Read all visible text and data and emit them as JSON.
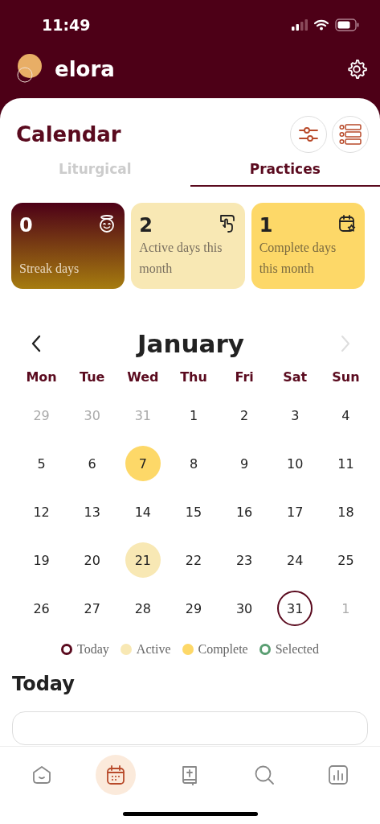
{
  "status_bar": {
    "time": "11:49"
  },
  "header": {
    "username": "elora"
  },
  "page": {
    "title": "Calendar"
  },
  "tabs": [
    {
      "label": "Liturgical",
      "selected": false
    },
    {
      "label": "Practices",
      "selected": true
    }
  ],
  "stats": [
    {
      "kind": "streak",
      "value": "0",
      "label": "Streak days"
    },
    {
      "kind": "active",
      "value": "2",
      "label": "Active days this month"
    },
    {
      "kind": "complete",
      "value": "1",
      "label": "Complete days this month"
    }
  ],
  "calendar": {
    "month": "January",
    "next_disabled": true,
    "weekdays": [
      "Mon",
      "Tue",
      "Wed",
      "Thu",
      "Fri",
      "Sat",
      "Sun"
    ],
    "days": [
      {
        "label": "29",
        "kind": "other"
      },
      {
        "label": "30",
        "kind": "other"
      },
      {
        "label": "31",
        "kind": "other"
      },
      {
        "label": "1",
        "kind": "plain"
      },
      {
        "label": "2",
        "kind": "plain"
      },
      {
        "label": "3",
        "kind": "plain"
      },
      {
        "label": "4",
        "kind": "plain"
      },
      {
        "label": "5",
        "kind": "plain"
      },
      {
        "label": "6",
        "kind": "plain"
      },
      {
        "label": "7",
        "kind": "complete"
      },
      {
        "label": "8",
        "kind": "plain"
      },
      {
        "label": "9",
        "kind": "plain"
      },
      {
        "label": "10",
        "kind": "plain"
      },
      {
        "label": "11",
        "kind": "plain"
      },
      {
        "label": "12",
        "kind": "plain"
      },
      {
        "label": "13",
        "kind": "plain"
      },
      {
        "label": "14",
        "kind": "plain"
      },
      {
        "label": "15",
        "kind": "plain"
      },
      {
        "label": "16",
        "kind": "plain"
      },
      {
        "label": "17",
        "kind": "plain"
      },
      {
        "label": "18",
        "kind": "plain"
      },
      {
        "label": "19",
        "kind": "plain"
      },
      {
        "label": "20",
        "kind": "plain"
      },
      {
        "label": "21",
        "kind": "active"
      },
      {
        "label": "22",
        "kind": "plain"
      },
      {
        "label": "23",
        "kind": "plain"
      },
      {
        "label": "24",
        "kind": "plain"
      },
      {
        "label": "25",
        "kind": "plain"
      },
      {
        "label": "26",
        "kind": "plain"
      },
      {
        "label": "27",
        "kind": "plain"
      },
      {
        "label": "28",
        "kind": "plain"
      },
      {
        "label": "29",
        "kind": "plain"
      },
      {
        "label": "30",
        "kind": "plain"
      },
      {
        "label": "31",
        "kind": "today"
      },
      {
        "label": "1",
        "kind": "other"
      }
    ]
  },
  "legend": [
    {
      "label": "Today",
      "kind": "ring",
      "color": "#5a0a1e"
    },
    {
      "label": "Active",
      "kind": "dot",
      "color": "#f8e8b4"
    },
    {
      "label": "Complete",
      "kind": "dot",
      "color": "#fdd868"
    },
    {
      "label": "Selected",
      "kind": "ring",
      "color": "#5a9e72"
    }
  ],
  "section": {
    "title": "Today"
  },
  "bottom_nav": [
    {
      "kind": "home",
      "selected": false
    },
    {
      "kind": "calendar",
      "selected": true
    },
    {
      "kind": "book",
      "selected": false
    },
    {
      "kind": "search",
      "selected": false
    },
    {
      "kind": "stats",
      "selected": false
    }
  ]
}
